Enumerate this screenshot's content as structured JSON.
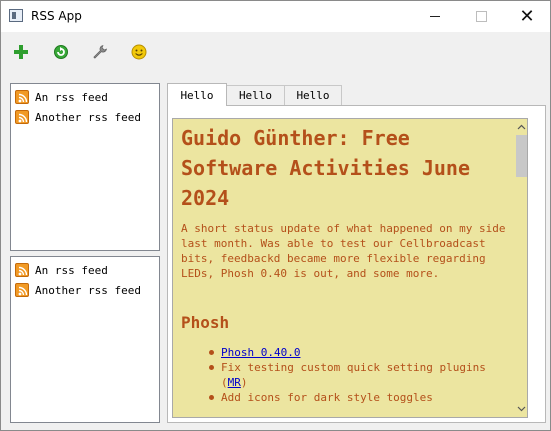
{
  "window": {
    "title": "RSS App",
    "controls": {
      "minimize": "minimize",
      "maximize": "maximize",
      "close": "✕"
    }
  },
  "toolbar": {
    "buttons": [
      {
        "icon": "add-icon",
        "color": "#2e9e2e"
      },
      {
        "icon": "refresh-icon",
        "color": "#38a838"
      },
      {
        "icon": "wrench-icon",
        "color": "#7a7a7a"
      },
      {
        "icon": "smiley-icon",
        "color": "#f2c90a"
      }
    ]
  },
  "feed_lists": [
    {
      "items": [
        {
          "label": "An rss feed",
          "icon": "rss-icon"
        },
        {
          "label": "Another rss feed",
          "icon": "rss-icon"
        }
      ]
    },
    {
      "items": [
        {
          "label": "An rss feed",
          "icon": "rss-icon"
        },
        {
          "label": "Another rss feed",
          "icon": "rss-icon"
        }
      ]
    }
  ],
  "tabs": [
    {
      "label": "Hello",
      "active": true
    },
    {
      "label": "Hello",
      "active": false
    },
    {
      "label": "Hello",
      "active": false
    }
  ],
  "article": {
    "title": "Guido Günther: Free Software Activities June 2024",
    "summary": "A short status update of what happened on my side last month. Was able to test our Cellbroadcast bits, feedbackd became more flexible regarding LEDs, Phosh 0.40 is out, and some more.",
    "section_heading": "Phosh",
    "bullets": {
      "item1": "Phosh 0.40.0",
      "item2_text": "Fix testing custom quick setting plugins (",
      "item2_link": "MR",
      "item2_end": ")",
      "item3": "Add icons for dark style toggles"
    }
  },
  "colors": {
    "content_background": "#ece5a0",
    "content_text": "#b4501a",
    "link": "#0000cc",
    "rss_orange": "#f19a26"
  }
}
